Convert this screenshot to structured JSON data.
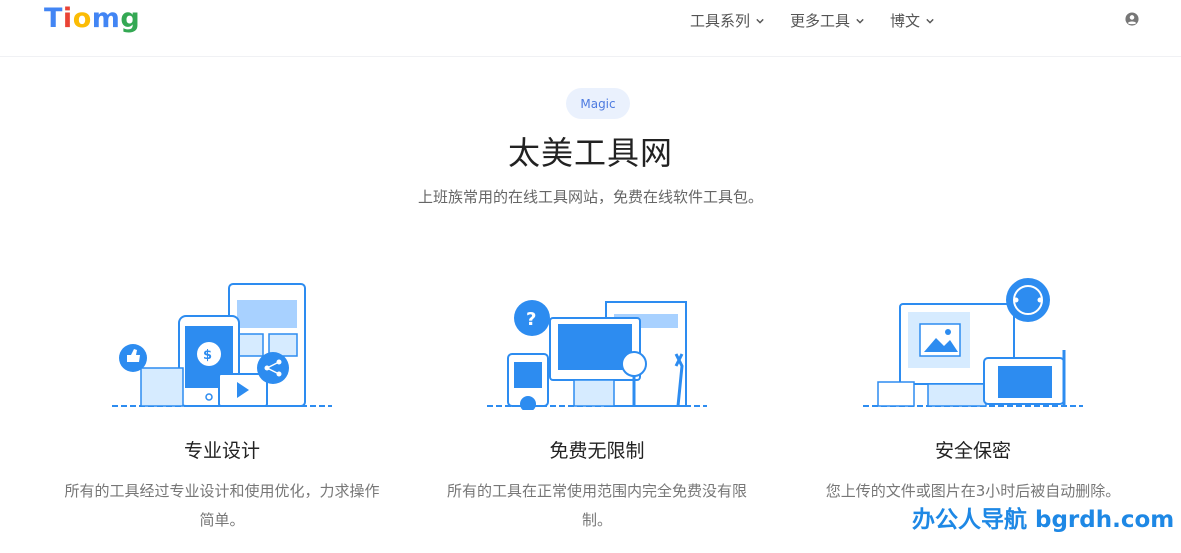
{
  "header": {
    "logo_letters": [
      {
        "char": "T",
        "color": "#4285f4"
      },
      {
        "char": "i",
        "color": "#ea4335"
      },
      {
        "char": "o",
        "color": "#fbbc05"
      },
      {
        "char": "m",
        "color": "#4285f4"
      },
      {
        "char": "g",
        "color": "#34a853"
      }
    ],
    "nav": [
      {
        "label": "工具系列"
      },
      {
        "label": "更多工具"
      },
      {
        "label": "博文"
      }
    ],
    "user_icon": "user-circle-icon"
  },
  "hero": {
    "tag": "Magic",
    "title": "太美工具网",
    "subtitle": "上班族常用的在线工具网站，免费在线软件工具包。"
  },
  "features": [
    {
      "title": "专业设计",
      "desc": "所有的工具经过专业设计和使用优化，力求操作简单。",
      "illustration": "phone-devices-illustration"
    },
    {
      "title": "免费无限制",
      "desc": "所有的工具在正常使用范围内完全免费没有限制。",
      "illustration": "monitor-question-illustration"
    },
    {
      "title": "安全保密",
      "desc": "您上传的文件或图片在3小时后被自动删除。",
      "illustration": "design-tablet-illustration"
    }
  ],
  "watermark": "办公人导航 bgrdh.com",
  "colors": {
    "accent": "#2d8cf0",
    "light": "#a8d1ff",
    "tag_bg": "#eaf1fd"
  }
}
